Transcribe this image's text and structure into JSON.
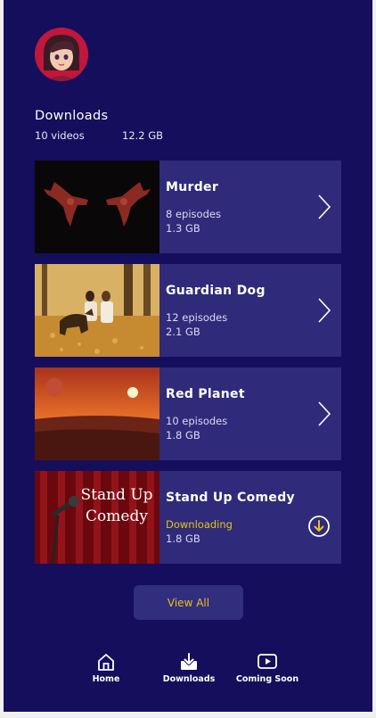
{
  "header": {
    "avatar_icon": "user-avatar"
  },
  "downloads": {
    "title": "Downloads",
    "count": "10 videos",
    "total_size": "12.2 GB"
  },
  "items": [
    {
      "title": "Murder",
      "subtitle": "8 episodes",
      "size": "1.3 GB",
      "action_icon": "chevron-right-icon"
    },
    {
      "title": "Guardian Dog",
      "subtitle": "12 episodes",
      "size": "2.1 GB",
      "action_icon": "chevron-right-icon"
    },
    {
      "title": "Red Planet",
      "subtitle": "10 episodes",
      "size": "1.8 GB",
      "action_icon": "chevron-right-icon"
    },
    {
      "title": "Stand Up Comedy",
      "subtitle": "Downloading",
      "size": "1.8 GB",
      "action_icon": "download-circle-icon",
      "thumb_text": [
        "Stand Up",
        "Comedy"
      ]
    }
  ],
  "view_all_label": "View All",
  "nav": [
    {
      "label": "Home",
      "icon": "home-icon"
    },
    {
      "label": "Downloads",
      "icon": "download-icon"
    },
    {
      "label": "Coming Soon",
      "icon": "play-icon"
    }
  ],
  "colors": {
    "background": "#150e5c",
    "card": "#2f2b7a",
    "accent": "#e6c21c"
  }
}
